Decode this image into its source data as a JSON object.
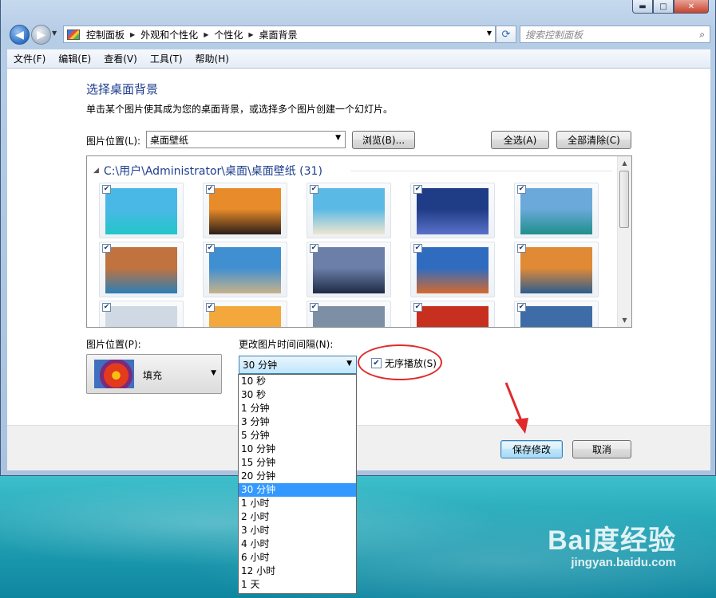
{
  "window": {
    "caption_buttons": {
      "minimize": "▬",
      "maximize": "□",
      "close": "✕"
    }
  },
  "address": {
    "crumbs": [
      "控制面板",
      "外观和个性化",
      "个性化",
      "桌面背景"
    ],
    "search_placeholder": "搜索控制面板"
  },
  "menubar": [
    "文件(F)",
    "编辑(E)",
    "查看(V)",
    "工具(T)",
    "帮助(H)"
  ],
  "page": {
    "title": "选择桌面背景",
    "subtitle": "单击某个图片使其成为您的桌面背景，或选择多个图片创建一个幻灯片。",
    "location_label": "图片位置(L):",
    "location_value": "桌面壁纸",
    "browse": "浏览(B)...",
    "select_all": "全选(A)",
    "clear_all": "全部清除(C)",
    "group_header": "C:\\用户\\Administrator\\桌面\\桌面壁纸 (31)",
    "position_label": "图片位置(P):",
    "position_value": "填充",
    "interval_label": "更改图片时间间隔(N):",
    "interval_value": "30 分钟",
    "shuffle_label": "无序播放(S)",
    "shuffle_checked": true,
    "save": "保存修改",
    "cancel": "取消"
  },
  "thumbnails": [
    {
      "checked": true,
      "colors": [
        "#4ab8e6",
        "#22c6c9"
      ]
    },
    {
      "checked": true,
      "colors": [
        "#e88b2a",
        "#2a1e18"
      ]
    },
    {
      "checked": true,
      "colors": [
        "#5bb9e5",
        "#efe6cf"
      ]
    },
    {
      "checked": true,
      "colors": [
        "#1f3c86",
        "#5a71c9"
      ]
    },
    {
      "checked": true,
      "colors": [
        "#6aa9d9",
        "#1f8f8c"
      ]
    },
    {
      "checked": true,
      "colors": [
        "#c0723f",
        "#2a7fb8"
      ]
    },
    {
      "checked": true,
      "colors": [
        "#3f8fd1",
        "#c7b28a"
      ]
    },
    {
      "checked": true,
      "colors": [
        "#6b7fa8",
        "#1e2a45"
      ]
    },
    {
      "checked": true,
      "colors": [
        "#2f6cc0",
        "#d46a2f"
      ]
    },
    {
      "checked": true,
      "colors": [
        "#e08a35",
        "#2c5d8e"
      ]
    },
    {
      "checked": true,
      "colors": [
        "#cfd9e3",
        "#5b6d4e"
      ]
    },
    {
      "checked": true,
      "colors": [
        "#f4a73b",
        "#2b5aa0"
      ]
    },
    {
      "checked": true,
      "colors": [
        "#7d8fa5",
        "#a88a63"
      ]
    },
    {
      "checked": true,
      "colors": [
        "#c72f1f",
        "#2a1a14"
      ]
    },
    {
      "checked": true,
      "colors": [
        "#3e6ca6",
        "#c07a4b"
      ]
    }
  ],
  "interval_options": {
    "items": [
      "10 秒",
      "30 秒",
      "1 分钟",
      "3 分钟",
      "5 分钟",
      "10 分钟",
      "15 分钟",
      "20 分钟",
      "30 分钟",
      "1 小时",
      "2 小时",
      "3 小时",
      "4 小时",
      "6 小时",
      "12 小时",
      "1 天"
    ],
    "selected_index": 8
  },
  "watermark": {
    "logo": "Bai度经验",
    "url": "jingyan.baidu.com"
  },
  "accent": {
    "title_blue": "#1e3e8e",
    "highlight": "#3399ff",
    "annotation_red": "#e02a2a"
  }
}
